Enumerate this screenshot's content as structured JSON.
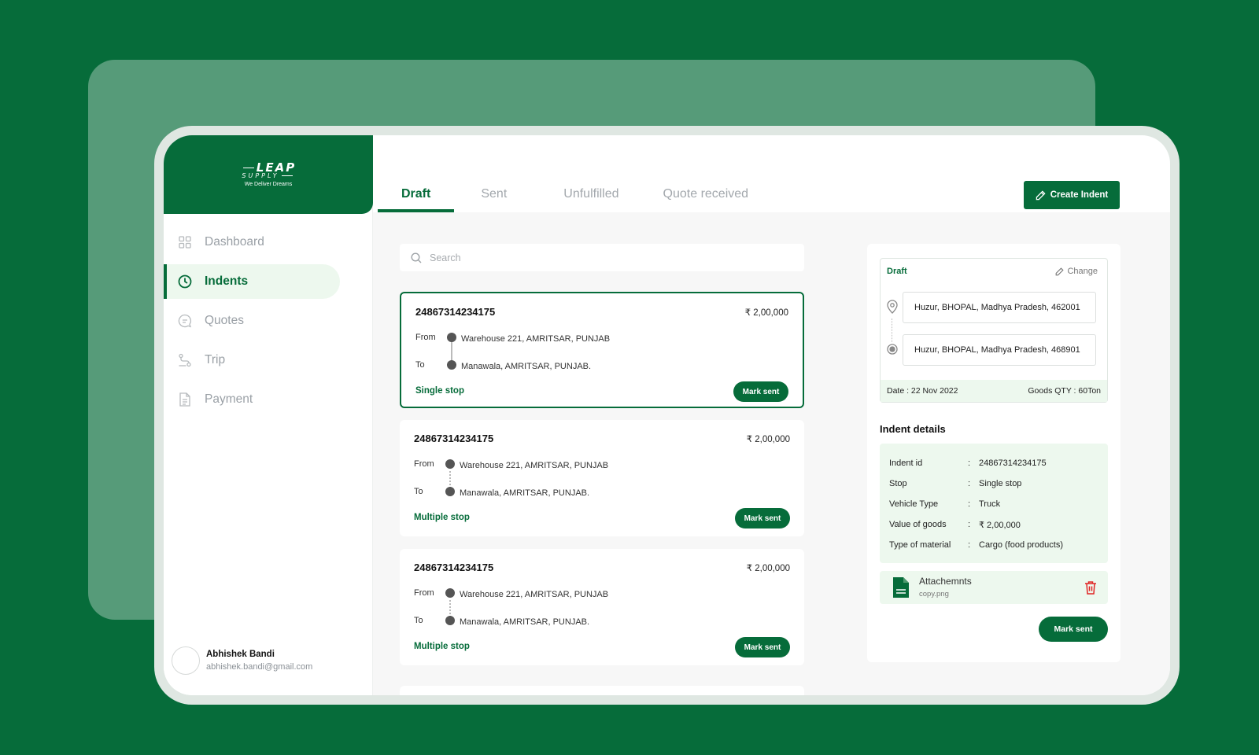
{
  "logo": {
    "line1": "LEAP",
    "line2": "SUPPLY",
    "tagline": "We Deliver Dreams"
  },
  "sidebar": {
    "items": [
      {
        "label": "Dashboard",
        "icon": "grid-icon",
        "active": false
      },
      {
        "label": "Indents",
        "icon": "clock-icon",
        "active": true
      },
      {
        "label": "Quotes",
        "icon": "quote-bubble-icon",
        "active": false
      },
      {
        "label": "Trip",
        "icon": "route-icon",
        "active": false
      },
      {
        "label": "Payment",
        "icon": "document-icon",
        "active": false
      }
    ],
    "user": {
      "name": "Abhishek Bandi",
      "email": "abhishek.bandi@gmail.com"
    }
  },
  "tabs": [
    "Draft",
    "Sent",
    "Unfulfilled",
    "Quote received"
  ],
  "active_tab": "Draft",
  "create_button": "Create Indent",
  "search": {
    "placeholder": "Search"
  },
  "cards": [
    {
      "id": "24867314234175",
      "price": "₹ 2,00,000",
      "from_label": "From",
      "to_label": "To",
      "from": "Warehouse 221, AMRITSAR, PUNJAB",
      "to": "Manawala, AMRITSAR, PUNJAB.",
      "stop": "Single stop",
      "action": "Mark sent"
    },
    {
      "id": "24867314234175",
      "price": "₹ 2,00,000",
      "from_label": "From",
      "to_label": "To",
      "from": "Warehouse 221, AMRITSAR, PUNJAB",
      "to": "Manawala, AMRITSAR, PUNJAB.",
      "stop": "Multiple stop",
      "action": "Mark sent"
    },
    {
      "id": "24867314234175",
      "price": "₹ 2,00,000",
      "from_label": "From",
      "to_label": "To",
      "from": "Warehouse 221, AMRITSAR, PUNJAB",
      "to": "Manawala, AMRITSAR, PUNJAB.",
      "stop": "Multiple stop",
      "action": "Mark sent"
    }
  ],
  "detail": {
    "status": "Draft",
    "change": "Change",
    "origin": "Huzur, BHOPAL, Madhya Pradesh, 462001",
    "destination": "Huzur, BHOPAL, Madhya Pradesh, 468901",
    "date": "Date : 22 Nov 2022",
    "goods_qty": "Goods QTY : 60Ton",
    "details_title": "Indent details",
    "rows": [
      {
        "key": "Indent id",
        "sep": ":",
        "value": "24867314234175"
      },
      {
        "key": "Stop",
        "sep": ":",
        "value": "Single stop"
      },
      {
        "key": "Vehicle Type",
        "sep": ":",
        "value": "Truck"
      },
      {
        "key": "Value of goods",
        "sep": ":",
        "value": "₹ 2,00,000"
      },
      {
        "key": "Type of material",
        "sep": ":",
        "value": "Cargo (food products)"
      }
    ],
    "attachment_title": "Attachemnts",
    "attachment_file": "copy.png",
    "action": "Mark sent"
  },
  "colors": {
    "brand": "#066c3a",
    "active_bg": "#edf8ee",
    "danger": "#e02424"
  }
}
